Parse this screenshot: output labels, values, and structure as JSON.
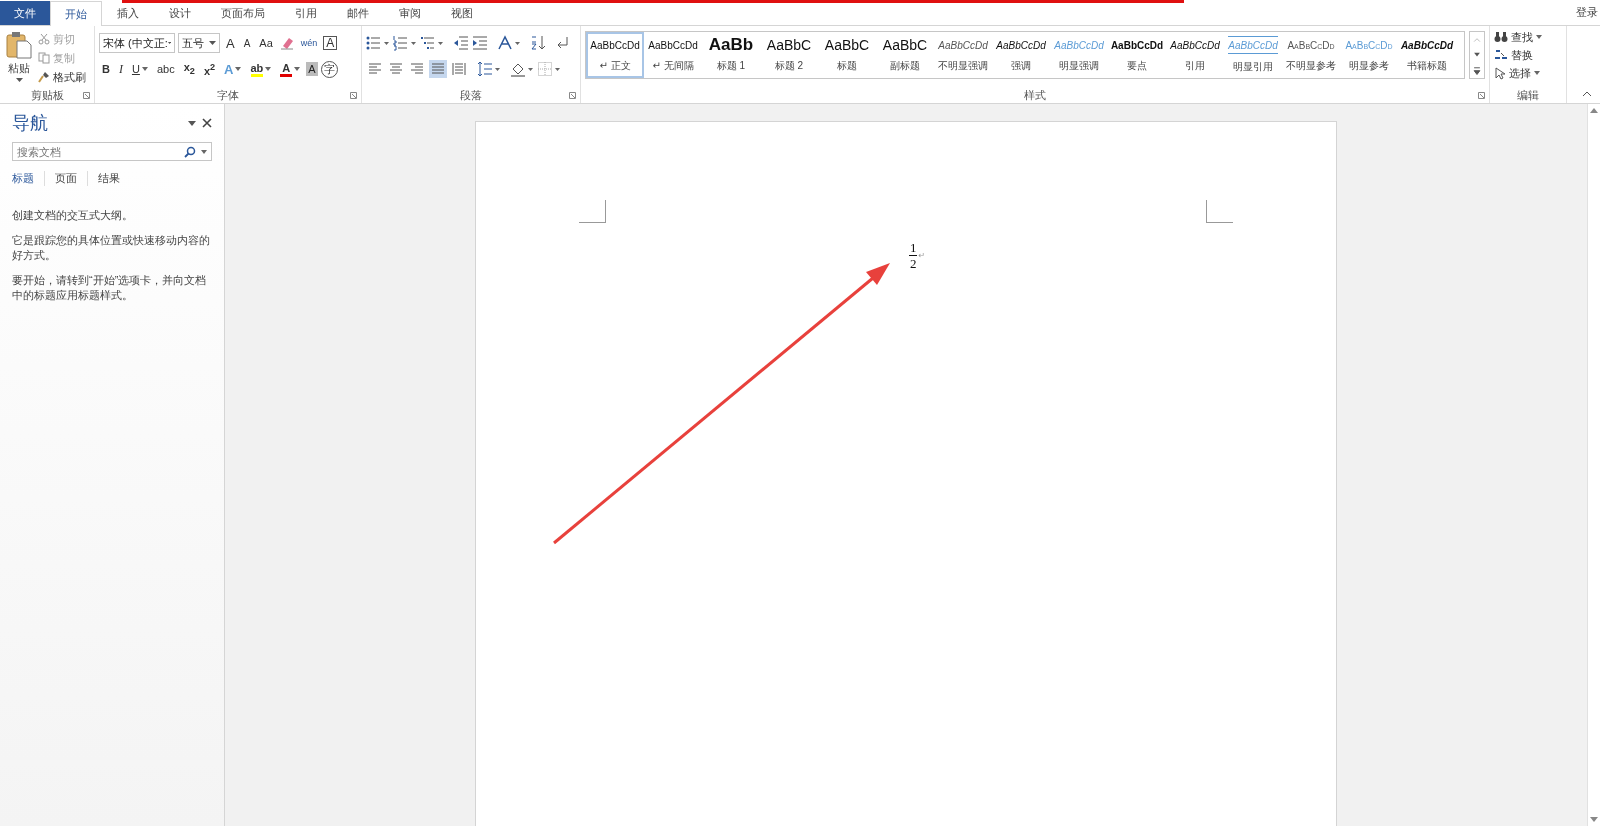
{
  "tabs": [
    {
      "label": "文件",
      "kind": "file",
      "selected": false
    },
    {
      "label": "开始",
      "kind": "tab",
      "selected": true
    },
    {
      "label": "插入",
      "kind": "tab",
      "selected": false
    },
    {
      "label": "设计",
      "kind": "tab",
      "selected": false
    },
    {
      "label": "页面布局",
      "kind": "tab",
      "selected": false
    },
    {
      "label": "引用",
      "kind": "tab",
      "selected": false
    },
    {
      "label": "邮件",
      "kind": "tab",
      "selected": false
    },
    {
      "label": "审阅",
      "kind": "tab",
      "selected": false
    },
    {
      "label": "视图",
      "kind": "tab",
      "selected": false
    }
  ],
  "account": "登录",
  "clipboard": {
    "paste": "粘贴",
    "label": "剪贴板",
    "actions": [
      {
        "label": "剪切",
        "kind": "cut",
        "disabled": true
      },
      {
        "label": "复制",
        "kind": "copy",
        "disabled": true
      },
      {
        "label": "格式刷",
        "kind": "painter",
        "disabled": false
      }
    ]
  },
  "font": {
    "label": "字体",
    "name": "宋体 (中文正:",
    "size": "五号",
    "row1": [
      {
        "kind": "grow",
        "label": "A"
      },
      {
        "kind": "shrink",
        "label": "A"
      },
      {
        "kind": "case",
        "label": "Aa"
      },
      {
        "kind": "clear"
      },
      {
        "kind": "phonetic",
        "label": "wén"
      },
      {
        "kind": "border",
        "label": "A"
      }
    ],
    "row2": [
      {
        "kind": "bold",
        "label": "B"
      },
      {
        "kind": "italic",
        "label": "I"
      },
      {
        "kind": "underline",
        "label": "U"
      },
      {
        "kind": "strike",
        "label": "abc"
      },
      {
        "kind": "sub",
        "label": "x$_{2}$"
      },
      {
        "kind": "sup",
        "label": "x$^{2}$"
      },
      {
        "kind": "effect",
        "label": "A"
      },
      {
        "kind": "highlight",
        "label": "ab",
        "color": "#ffff00"
      },
      {
        "kind": "fontcolor",
        "label": "A",
        "color": "#e00000"
      },
      {
        "kind": "shading",
        "label": "A"
      },
      {
        "kind": "enclose",
        "label": "字"
      }
    ]
  },
  "paragraph": {
    "label": "段落",
    "alignments": [
      {
        "kind": "left",
        "selected": false
      },
      {
        "kind": "center",
        "selected": false
      },
      {
        "kind": "right",
        "selected": false
      },
      {
        "kind": "justify",
        "selected": true
      },
      {
        "kind": "distribute",
        "selected": false
      }
    ]
  },
  "styles": {
    "label": "样式",
    "items": [
      {
        "preview": "AaBbCcDd",
        "name": "↵ 正文",
        "kind": "normal",
        "selected": true
      },
      {
        "preview": "AaBbCcDd",
        "name": "↵ 无间隔",
        "kind": "normal",
        "selected": false
      },
      {
        "preview": "AaBb",
        "name": "标题 1",
        "kind": "h1",
        "selected": false
      },
      {
        "preview": "AaBbC",
        "name": "标题 2",
        "kind": "h2",
        "selected": false
      },
      {
        "preview": "AaBbC",
        "name": "标题",
        "kind": "h2",
        "selected": false
      },
      {
        "preview": "AaBbC",
        "name": "副标题",
        "kind": "h2",
        "selected": false
      },
      {
        "preview": "AaBbCcDd",
        "name": "不明显强调",
        "kind": "subtle",
        "selected": false
      },
      {
        "preview": "AaBbCcDd",
        "name": "强调",
        "kind": "emphasis",
        "selected": false
      },
      {
        "preview": "AaBbCcDd",
        "name": "明显强调",
        "kind": "intense",
        "selected": false
      },
      {
        "preview": "AaBbCcDd",
        "name": "要点",
        "kind": "strong",
        "selected": false
      },
      {
        "preview": "AaBbCcDd",
        "name": "引用",
        "kind": "emphasis",
        "selected": false
      },
      {
        "preview": "AaBbCcDd",
        "name": "明显引用",
        "kind": "quote",
        "selected": false
      },
      {
        "preview": "AaBbCcDd",
        "name": "不明显参考",
        "kind": "subref",
        "selected": false
      },
      {
        "preview": "AaBbCcDd",
        "name": "明显参考",
        "kind": "intref",
        "selected": false
      },
      {
        "preview": "AaBbCcDd",
        "name": "书籍标题",
        "kind": "book",
        "selected": false
      }
    ]
  },
  "editing": {
    "label": "编辑",
    "find": "查找",
    "replace": "替换",
    "select": "选择"
  },
  "navigation": {
    "title": "导航",
    "search_placeholder": "搜索文档",
    "tabs": [
      {
        "label": "标题",
        "selected": true
      },
      {
        "label": "页面",
        "selected": false
      },
      {
        "label": "结果",
        "selected": false
      }
    ],
    "paragraphs": [
      "创建文档的交互式大纲。",
      "它是跟踪您的具体位置或快速移动内容的好方式。",
      "要开始，请转到“开始”选项卡，并向文档中的标题应用标题样式。"
    ]
  },
  "document": {
    "numerator": "1",
    "denominator": "2",
    "paragraph_mark": "↵"
  }
}
